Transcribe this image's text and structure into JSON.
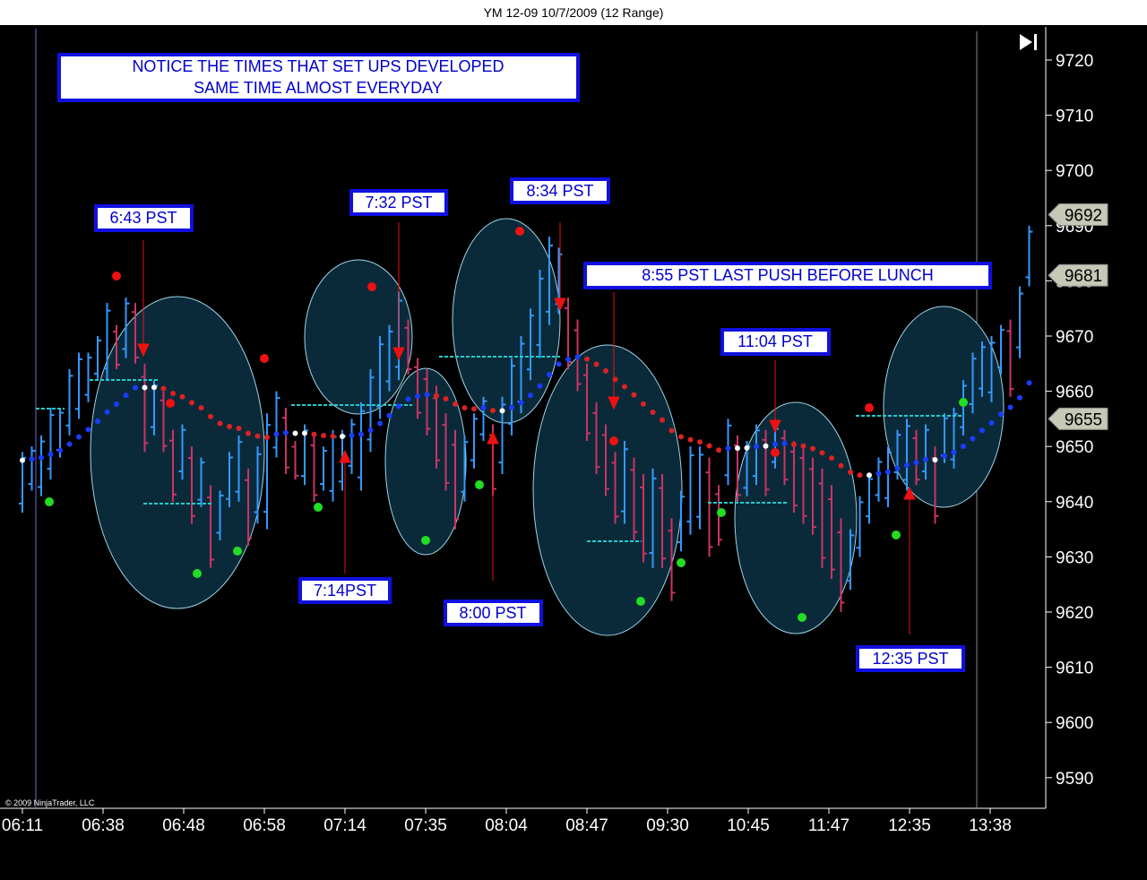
{
  "window_title": "YM 12-09  10/7/2009 (12 Range)",
  "copyright": "© 2009 NinjaTrader, LLC",
  "colors": {
    "background": "#000000",
    "up_bar": "#3399ff",
    "down_bar": "#cc3366",
    "ellipse_fill": "#0a2a3a",
    "ellipse_stroke": "#9fd4e8",
    "note_border": "#1010e0",
    "note_text": "#0000cc",
    "dot_red": "#dd2222",
    "dot_white": "#ffffff",
    "dot_blue": "#1a3cff",
    "swing_high": "#ee1111",
    "swing_low": "#22dd22",
    "level_line": "#22cccc",
    "price_marker": "#c8c8b8"
  },
  "chart_data": {
    "type": "candlestick",
    "ylim": [
      9581,
      9728
    ],
    "y_ticks": [
      9720,
      9710,
      9700,
      9690,
      9680,
      9670,
      9660,
      9650,
      9640,
      9630,
      9620,
      9610,
      9600,
      9590
    ],
    "x_ticks": [
      "06:11",
      "06:38",
      "06:48",
      "06:58",
      "07:14",
      "07:35",
      "08:04",
      "08:47",
      "09:30",
      "10:45",
      "11:47",
      "12:35",
      "13:38"
    ],
    "bars": [
      [
        9649,
        9638
      ],
      [
        9650,
        9642
      ],
      [
        9652,
        9641
      ],
      [
        9657,
        9644
      ],
      [
        9657,
        9648
      ],
      [
        9664,
        9652
      ],
      [
        9667,
        9655
      ],
      [
        9667,
        9658
      ],
      [
        9670,
        9662
      ],
      [
        9676,
        9662
      ],
      [
        9672,
        9664
      ],
      [
        9677,
        9666
      ],
      [
        9676,
        9665
      ],
      [
        9665,
        9649
      ],
      [
        9662,
        9652
      ],
      [
        9660,
        9649
      ],
      [
        9653,
        9640
      ],
      [
        9654,
        9644
      ],
      [
        9650,
        9636
      ],
      [
        9648,
        9639
      ],
      [
        9643,
        9628
      ],
      [
        9642,
        9633
      ],
      [
        9649,
        9639
      ],
      [
        9652,
        9640
      ],
      [
        9646,
        9632
      ],
      [
        9650,
        9636
      ],
      [
        9656,
        9635
      ],
      [
        9660,
        9648
      ],
      [
        9657,
        9645
      ],
      [
        9651,
        9644
      ],
      [
        9654,
        9643
      ],
      [
        9652,
        9640
      ],
      [
        9650,
        9642
      ],
      [
        9653,
        9640
      ],
      [
        9653,
        9642
      ],
      [
        9655,
        9645
      ],
      [
        9658,
        9642
      ],
      [
        9664,
        9649
      ],
      [
        9670,
        9655
      ],
      [
        9672,
        9660
      ],
      [
        9678,
        9662
      ],
      [
        9673,
        9663
      ],
      [
        9666,
        9655
      ],
      [
        9664,
        9652
      ],
      [
        9661,
        9646
      ],
      [
        9656,
        9642
      ],
      [
        9653,
        9635
      ],
      [
        9652,
        9640
      ],
      [
        9656,
        9646
      ],
      [
        9659,
        9651
      ],
      [
        9654,
        9641
      ],
      [
        9659,
        9645
      ],
      [
        9666,
        9652
      ],
      [
        9670,
        9656
      ],
      [
        9675,
        9662
      ],
      [
        9682,
        9666
      ],
      [
        9688,
        9672
      ],
      [
        9686,
        9674
      ],
      [
        9677,
        9664
      ],
      [
        9673,
        9660
      ],
      [
        9665,
        9651
      ],
      [
        9658,
        9645
      ],
      [
        9654,
        9641
      ],
      [
        9649,
        9636
      ],
      [
        9651,
        9636
      ],
      [
        9648,
        9633
      ],
      [
        9645,
        9629
      ],
      [
        9646,
        9628
      ],
      [
        9645,
        9628
      ],
      [
        9637,
        9622
      ],
      [
        9642,
        9631
      ],
      [
        9650,
        9634
      ],
      [
        9650,
        9635
      ],
      [
        9648,
        9630
      ],
      [
        9643,
        9632
      ],
      [
        9655,
        9643
      ],
      [
        9652,
        9640
      ],
      [
        9651,
        9641
      ],
      [
        9654,
        9643
      ],
      [
        9653,
        9641
      ],
      [
        9654,
        9646
      ],
      [
        9653,
        9643
      ],
      [
        9651,
        9638
      ],
      [
        9650,
        9636
      ],
      [
        9648,
        9634
      ],
      [
        9646,
        9628
      ],
      [
        9643,
        9626
      ],
      [
        9637,
        9620
      ],
      [
        9635,
        9624
      ],
      [
        9641,
        9630
      ],
      [
        9645,
        9636
      ],
      [
        9648,
        9640
      ],
      [
        9650,
        9639
      ],
      [
        9653,
        9644
      ],
      [
        9655,
        9642
      ],
      [
        9653,
        9643
      ],
      [
        9654,
        9644
      ],
      [
        9650,
        9636
      ],
      [
        9656,
        9647
      ],
      [
        9657,
        9646
      ],
      [
        9662,
        9652
      ],
      [
        9667,
        9656
      ],
      [
        9669,
        9659
      ],
      [
        9670,
        9658
      ],
      [
        9672,
        9663
      ],
      [
        9673,
        9659
      ],
      [
        9679,
        9666
      ],
      [
        9690,
        9679
      ]
    ],
    "current_price_markers": [
      9692,
      9681,
      9655
    ]
  },
  "annotations": {
    "main_note_line1": "NOTICE THE TIMES THAT SET UPS DEVELOPED",
    "main_note_line2": "SAME TIME ALMOST EVERYDAY",
    "labels": [
      "6:43 PST",
      "7:32 PST",
      "8:34 PST",
      "8:55 PST LAST PUSH BEFORE LUNCH",
      "11:04 PST",
      "7:14PST",
      "8:00 PST",
      "12:35 PST"
    ]
  }
}
